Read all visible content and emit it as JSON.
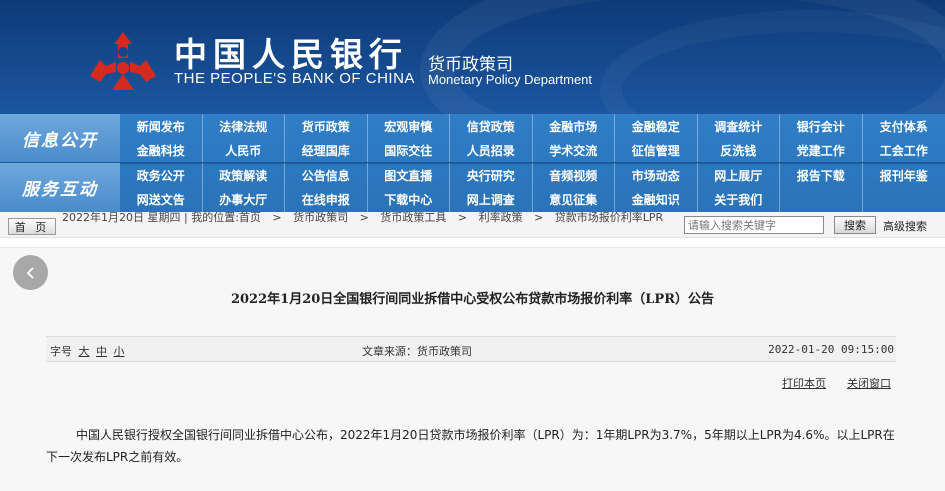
{
  "header": {
    "bank_name_cn": "中国人民银行",
    "bank_name_en": "THE PEOPLE'S BANK OF CHINA",
    "dept_cn": "货币政策司",
    "dept_en": "Monetary Policy Department",
    "colors": {
      "banner": "#14478a",
      "emblem": "#d42a1f",
      "nav": "#2f7ec6"
    }
  },
  "nav": {
    "band1_label": "信息公开",
    "band2_label": "服务互动",
    "band1_items": [
      "新闻发布",
      "法律法规",
      "货币政策",
      "宏观审慎",
      "信贷政策",
      "金融市场",
      "金融稳定",
      "调查统计",
      "银行会计",
      "支付体系",
      "金融科技",
      "人民币",
      "经理国库",
      "国际交往",
      "人员招录",
      "学术交流",
      "征信管理",
      "反洗钱",
      "党建工作",
      "工会工作"
    ],
    "band2_items": [
      "政务公开",
      "政策解读",
      "公告信息",
      "图文直播",
      "央行研究",
      "音频视频",
      "市场动态",
      "网上展厅",
      "报告下载",
      "报刊年鉴",
      "网送文告",
      "办事大厅",
      "在线申报",
      "下载中心",
      "网上调查",
      "意见征集",
      "金融知识",
      "关于我们",
      "",
      ""
    ]
  },
  "breadcrumb": {
    "home": "首 页",
    "date": "2022年1月20日 星期四",
    "location_label": "我的位置:首页",
    "sep": ">",
    "items": [
      "货币政策司",
      "货币政策工具",
      "利率政策",
      "贷款市场报价利率LPR"
    ]
  },
  "search": {
    "placeholder": "请输入搜索关键字",
    "button": "搜索",
    "advanced": "高级搜索"
  },
  "article": {
    "title": "2022年1月20日全国银行间同业拆借中心受权公布贷款市场报价利率（LPR）公告",
    "fontsize_label": "字号",
    "fontsize_options": [
      "大",
      "中",
      "小"
    ],
    "source": "文章来源：货币政策司",
    "datetime": "2022-01-20 09:15:00",
    "print": "打印本页",
    "close": "关闭窗口",
    "body": "中国人民银行授权全国银行间同业拆借中心公布，2022年1月20日贷款市场报价利率（LPR）为：1年期LPR为3.7%，5年期以上LPR为4.6%。以上LPR在下一次发布LPR之前有效。"
  }
}
